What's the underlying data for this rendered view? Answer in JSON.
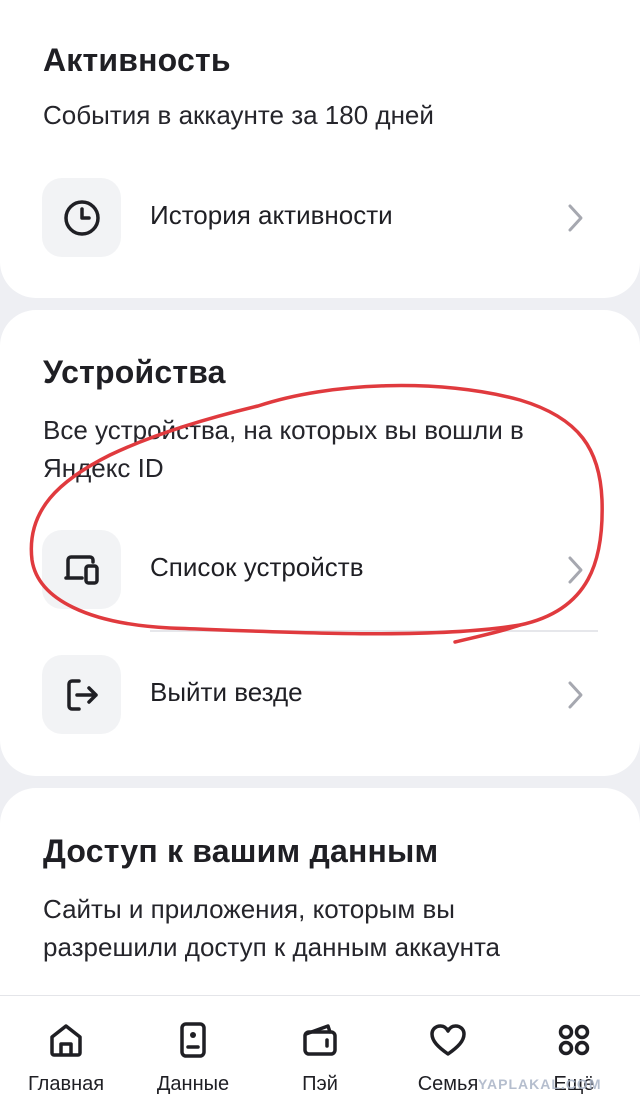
{
  "activity": {
    "title": "Активность",
    "subtitle": "События в аккаунте за 180 дней",
    "items": [
      {
        "label": "История активности",
        "icon": "clock-icon"
      }
    ]
  },
  "devices": {
    "title": "Устройства",
    "subtitle": "Все устройства, на которых вы вошли в Яндекс ID",
    "items": [
      {
        "label": "Список устройств",
        "icon": "devices-icon"
      },
      {
        "label": "Выйти везде",
        "icon": "logout-icon"
      }
    ]
  },
  "access": {
    "title": "Доступ к вашим данным",
    "subtitle": "Сайты и приложения, которым вы разрешили доступ к данным аккаунта"
  },
  "bottom_nav": {
    "items": [
      {
        "label": "Главная",
        "icon": "home-icon"
      },
      {
        "label": "Данные",
        "icon": "id-card-icon"
      },
      {
        "label": "Пэй",
        "icon": "wallet-icon"
      },
      {
        "label": "Семья",
        "icon": "heart-icon"
      },
      {
        "label": "Ещё",
        "icon": "grid-icon"
      }
    ]
  },
  "watermark": "YAPLAKAL.COM",
  "colors": {
    "background": "#EEEFF3",
    "card": "#FFFFFF",
    "icon_tile": "#F2F3F5",
    "annotation": "#E03A3E"
  }
}
